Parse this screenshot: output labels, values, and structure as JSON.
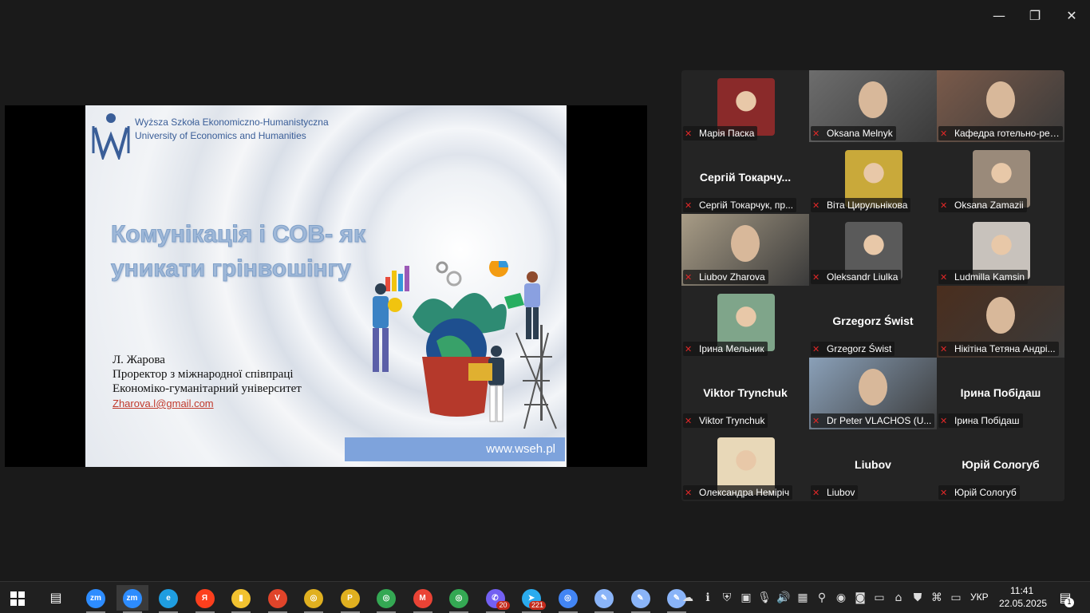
{
  "window": {
    "minimize_icon": "—",
    "restore_icon": "❐",
    "close_icon": "✕"
  },
  "slide": {
    "university_line1": "Wyższa Szkoła Ekonomiczno-Humanistyczna",
    "university_line2": "University of Economics and Humanities",
    "title": "Комунікація і СОВ- як уникати грінвошінгу",
    "author_name": "Л. Жарова",
    "author_role": "Проректор з міжнародної співпраці",
    "author_org": "Економіко-гуманітарний університет",
    "author_email": "Zharova.l@gmail.com",
    "url": "www.wseh.pl"
  },
  "participants": [
    {
      "name": "Марія Паска",
      "display": "avatar",
      "color": "#8a2a2a"
    },
    {
      "name": "Oksana Melnyk",
      "display": "video",
      "color": "#6d6d6d"
    },
    {
      "name": "Кафедра готельно-ресторанного",
      "display": "video",
      "color": "#7a5a4a"
    },
    {
      "name": "Сергій Токарчук, пр...",
      "big": "Сергій  Токарчу...",
      "display": "name"
    },
    {
      "name": "Віта Цирульнікова",
      "display": "avatar",
      "color": "#c9a93a"
    },
    {
      "name": "Oksana Zamazii",
      "display": "avatar",
      "color": "#9a8a7a"
    },
    {
      "name": "Liubov Zharova",
      "display": "video",
      "color": "#a89c86",
      "active": true
    },
    {
      "name": "Oleksandr Liulka",
      "display": "avatar",
      "color": "#5a5a5a"
    },
    {
      "name": "Ludmilla Kamsin",
      "display": "avatar",
      "color": "#c8c2bc"
    },
    {
      "name": "Ірина Мельник",
      "display": "avatar",
      "color": "#7fa58a"
    },
    {
      "name": "Grzegorz Świst",
      "big": "Grzegorz Świst",
      "display": "name"
    },
    {
      "name": "Нікітіна Тетяна Андрі...",
      "display": "video",
      "color": "#4a2e1e"
    },
    {
      "name": "Viktor Trynchuk",
      "big": "Viktor Trynchuk",
      "display": "name"
    },
    {
      "name": "Dr Peter VLACHOS (U...",
      "display": "video",
      "color": "#8aa0b8"
    },
    {
      "name": "Ірина Побідаш",
      "big": "Ірина Побідаш",
      "display": "name"
    },
    {
      "name": "Олександра Немірiч",
      "display": "avatar",
      "color": "#e8d8b8"
    },
    {
      "name": "Liubov",
      "big": "Liubov",
      "display": "name"
    },
    {
      "name": "Юрій Сологуб",
      "big": "Юрій Сологуб",
      "display": "name"
    }
  ],
  "taskbar": {
    "apps": [
      {
        "label": "zm",
        "color": "#2d8cff"
      },
      {
        "label": "zm",
        "color": "#2d8cff"
      },
      {
        "label": "e",
        "color": "#1f9de0"
      },
      {
        "label": "Я",
        "color": "#fc3f1d"
      },
      {
        "label": "▮",
        "color": "#f2c230"
      },
      {
        "label": "V",
        "color": "#e0442a"
      },
      {
        "label": "◎",
        "color": "#e0b020"
      },
      {
        "label": "P",
        "color": "#e0b020"
      },
      {
        "label": "◎",
        "color": "#34a853"
      },
      {
        "label": "M",
        "color": "#ea4335"
      },
      {
        "label": "◎",
        "color": "#34a853"
      },
      {
        "label": "✆",
        "color": "#7360f2"
      },
      {
        "label": "➤",
        "color": "#2aabee"
      },
      {
        "label": "◎",
        "color": "#4285f4"
      },
      {
        "label": "✎",
        "color": "#8ab4f8"
      },
      {
        "label": "✎",
        "color": "#8ab4f8"
      },
      {
        "label": "✎",
        "color": "#8ab4f8"
      }
    ],
    "viber_badge": "20",
    "telegram_badge": "221",
    "language": "УКР",
    "time": "11:41",
    "date": "22.05.2025",
    "notifications_count": "1"
  }
}
